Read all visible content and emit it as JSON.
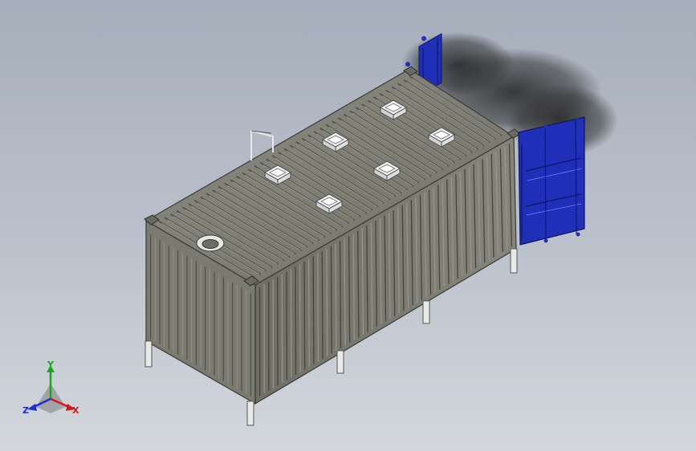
{
  "viewport": {
    "background_top": "#a6aebb",
    "background_bottom": "#d3d7dd"
  },
  "model": {
    "body_color": "#7d7d72",
    "door_color": "#1f2fb8",
    "vent_color": "#e9eaec",
    "vent_count": 6,
    "open_doors": 2,
    "roof_hatch": "circular"
  },
  "triad": {
    "x_label": "X",
    "y_label": "Y",
    "z_label": "Z",
    "x_color": "#d31a1a",
    "y_color": "#18a818",
    "z_color": "#1a2fd6"
  }
}
